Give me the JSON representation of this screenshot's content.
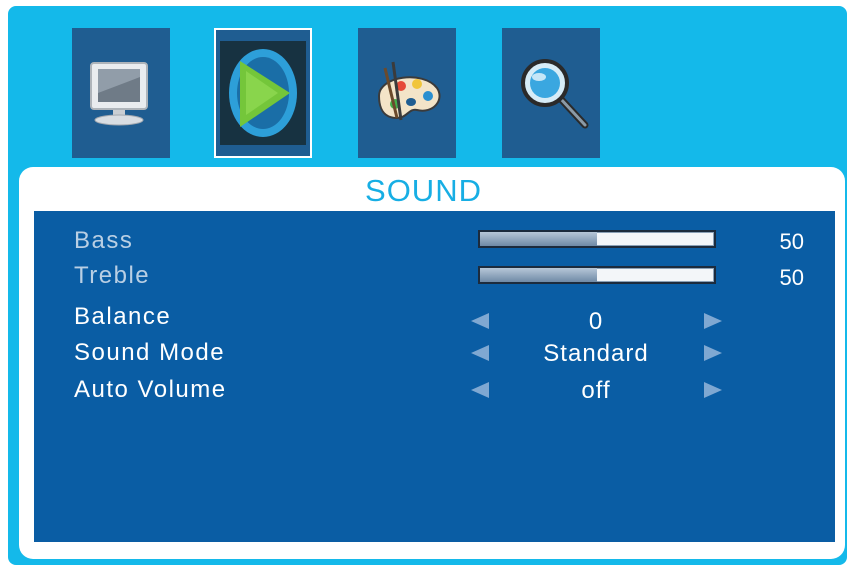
{
  "menu": {
    "tabs": [
      {
        "icon": "monitor-icon",
        "selected": false
      },
      {
        "icon": "sound-speaker-icon",
        "selected": true
      },
      {
        "icon": "palette-icon",
        "selected": false
      },
      {
        "icon": "magnifier-icon",
        "selected": false
      }
    ],
    "title": "SOUND"
  },
  "items": {
    "bass": {
      "label": "Bass",
      "value": "50",
      "level": 0.5,
      "enabled": false
    },
    "treble": {
      "label": "Treble",
      "value": "50",
      "level": 0.5,
      "enabled": false
    },
    "balance": {
      "label": "Balance",
      "value": "0",
      "enabled": true
    },
    "sound_mode": {
      "label": "Sound Mode",
      "value": "Standard",
      "enabled": true
    },
    "auto_volume": {
      "label": "Auto Volume",
      "value": "off",
      "enabled": true
    }
  },
  "colors": {
    "frame": "#14b9ea",
    "panel": "#0a5da4",
    "tile": "#1f5d91",
    "title": "#17aee4",
    "arrow": "#7fa8d2"
  }
}
